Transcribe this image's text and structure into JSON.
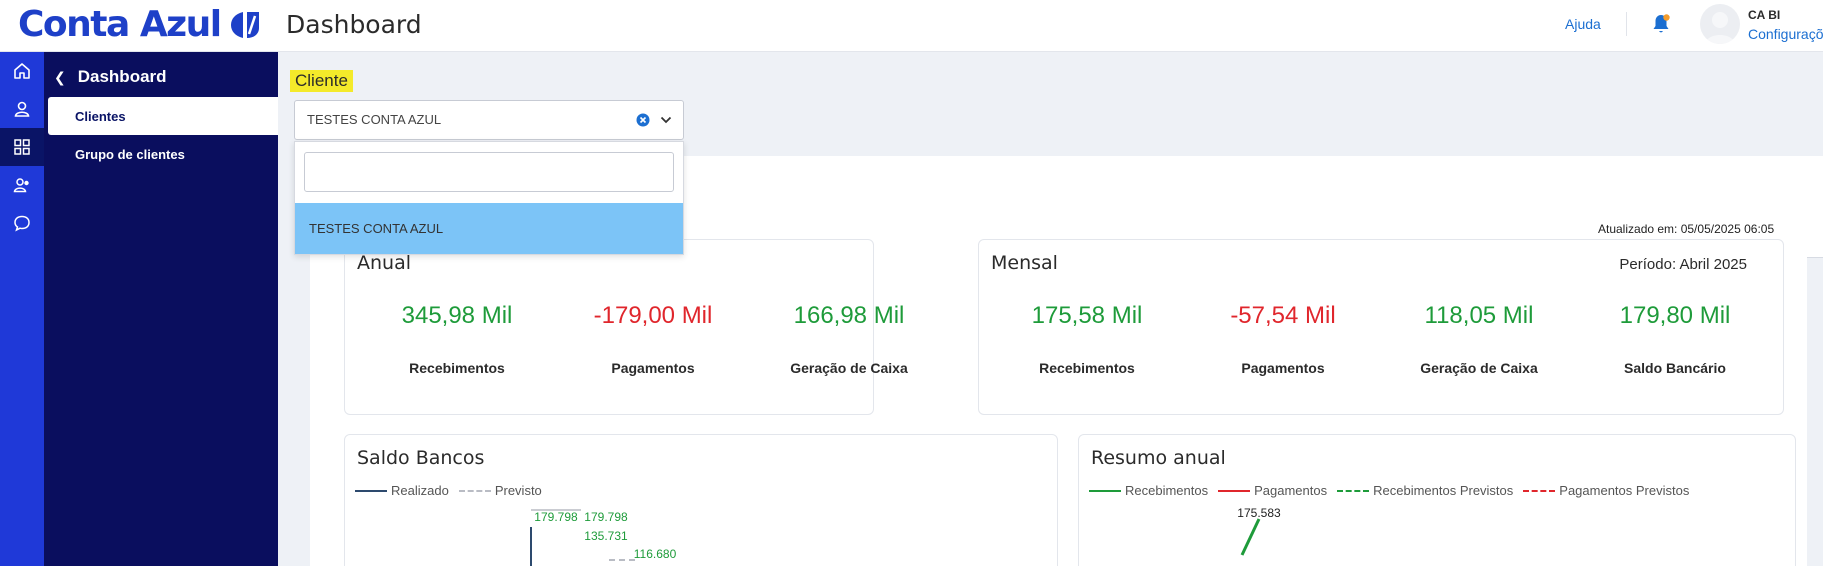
{
  "header": {
    "logo_text": "Conta Azul",
    "title": "Dashboard",
    "help": "Ajuda",
    "user_name": "CA BI",
    "user_link": "Configurações",
    "brand_color": "#1e40c8"
  },
  "rail": {
    "items": [
      {
        "icon": "home-icon"
      },
      {
        "icon": "user-icon"
      },
      {
        "icon": "grid-icon",
        "active": true
      },
      {
        "icon": "users-icon"
      },
      {
        "icon": "chat-icon"
      }
    ]
  },
  "sidebar": {
    "header": "Dashboard",
    "items": [
      {
        "label": "Clientes",
        "active": true
      },
      {
        "label": "Grupo de clientes"
      }
    ]
  },
  "filter": {
    "label": "Cliente",
    "selected": "TESTES CONTA AZUL",
    "search_value": "",
    "options": [
      "TESTES CONTA AZUL"
    ]
  },
  "updated": "Atualizado em: 05/05/2025 06:05",
  "anual": {
    "title": "Anual",
    "kpis": [
      {
        "value": "345,98 Mil",
        "label": "Recebimentos",
        "color": "green"
      },
      {
        "value": "-179,00 Mil",
        "label": "Pagamentos",
        "color": "red"
      },
      {
        "value": "166,98 Mil",
        "label": "Geração de Caixa",
        "color": "green"
      }
    ]
  },
  "mensal": {
    "title": "Mensal",
    "period": "Período: Abril 2025",
    "kpis": [
      {
        "value": "175,58 Mil",
        "label": "Recebimentos",
        "color": "green"
      },
      {
        "value": "-57,54 Mil",
        "label": "Pagamentos",
        "color": "red"
      },
      {
        "value": "118,05 Mil",
        "label": "Geração de Caixa",
        "color": "green"
      },
      {
        "value": "179,80 Mil",
        "label": "Saldo Bancário",
        "color": "green"
      }
    ]
  },
  "saldo": {
    "title": "Saldo Bancos",
    "legend": [
      "Realizado",
      "Previsto"
    ]
  },
  "resumo": {
    "title": "Resumo anual",
    "legend": [
      "Recebimentos",
      "Pagamentos",
      "Recebimentos Previstos",
      "Pagamentos Previstos"
    ]
  },
  "chart_data": [
    {
      "type": "line",
      "series": [
        {
          "name": "Realizado",
          "values": [
            179798
          ]
        },
        {
          "name": "Previsto",
          "values": [
            179798,
            135731,
            116680
          ]
        }
      ],
      "data_labels": [
        "179.798",
        "179.798",
        "135.731",
        "116.680"
      ],
      "colors": {
        "Realizado": "#2d4a6e",
        "Previsto": "#b9bcc4",
        "labels": "#1e9b3a"
      }
    },
    {
      "type": "line",
      "series": [
        {
          "name": "Recebimentos",
          "values": [
            175583
          ]
        }
      ],
      "data_labels": [
        "175.583"
      ],
      "colors": {
        "Recebimentos": "#1e9b3a",
        "Pagamentos": "#e0262c",
        "Recebimentos Previstos": "#1e9b3a",
        "Pagamentos Previstos": "#e0262c"
      }
    }
  ]
}
